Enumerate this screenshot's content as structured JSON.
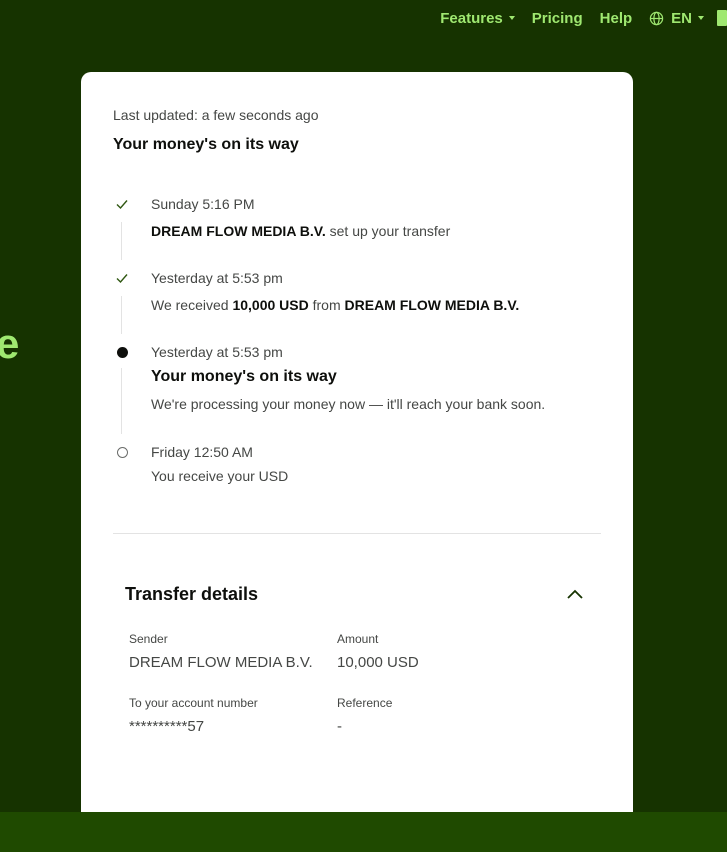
{
  "nav": {
    "items": [
      {
        "label": "Features",
        "dropdown": true
      },
      {
        "label": "Pricing",
        "dropdown": false
      },
      {
        "label": "Help",
        "dropdown": false
      }
    ],
    "language": "EN",
    "globe_icon": "globe-icon"
  },
  "hero_fragment": "e",
  "card": {
    "last_updated": "Last updated: a few seconds ago",
    "title": "Your money's on its way",
    "timeline": [
      {
        "status": "done",
        "when": "Sunday 5:16 PM",
        "desc_parts": [
          {
            "text": "DREAM FLOW MEDIA B.V.",
            "bold": true
          },
          {
            "text": " set up your transfer",
            "bold": false
          }
        ]
      },
      {
        "status": "done",
        "when": "Yesterday at 5:53 pm",
        "desc_parts": [
          {
            "text": "We received ",
            "bold": false
          },
          {
            "text": "10,000 USD",
            "bold": true
          },
          {
            "text": " from ",
            "bold": false
          },
          {
            "text": "DREAM FLOW MEDIA B.V.",
            "bold": true
          }
        ]
      },
      {
        "status": "current",
        "when": "Yesterday at 5:53 pm",
        "heading": "Your money's on its way",
        "desc_parts": [
          {
            "text": "We're processing your money now — it'll reach your bank soon.",
            "bold": false
          }
        ]
      },
      {
        "status": "pending",
        "when": "Friday 12:50 AM",
        "desc_parts": [
          {
            "text": "You receive your USD",
            "bold": false
          }
        ]
      }
    ],
    "details": {
      "title": "Transfer details",
      "expanded": true,
      "fields": [
        {
          "label": "Sender",
          "value": "DREAM FLOW MEDIA B.V."
        },
        {
          "label": "Amount",
          "value": "10,000 USD"
        },
        {
          "label": "To your account number",
          "value": "**********57"
        },
        {
          "label": "Reference",
          "value": "-"
        }
      ]
    }
  },
  "colors": {
    "background": "#163300",
    "accent": "#9fe870",
    "card": "#ffffff",
    "check": "#2f5711",
    "bottom_strip": "#1f4a00"
  }
}
